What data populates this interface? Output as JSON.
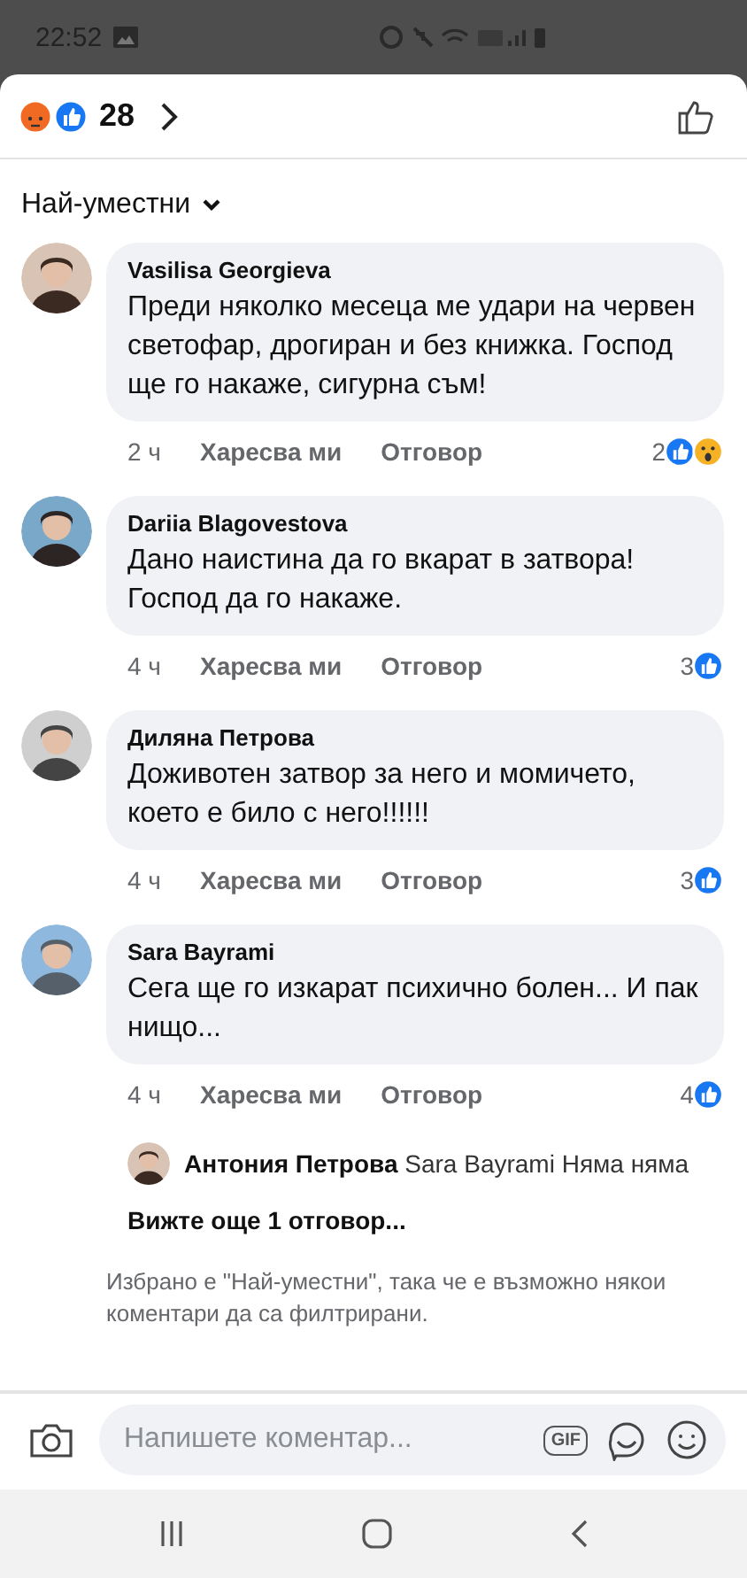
{
  "status_bar": {
    "time": "22:52"
  },
  "header": {
    "reactions": [
      {
        "kind": "angry"
      },
      {
        "kind": "like"
      }
    ],
    "count": "28"
  },
  "sort": {
    "label": "Най-уместни"
  },
  "comments": [
    {
      "author": "Vasilisa Georgieva",
      "text": "Преди няколко месеца ме удари на червен светофар, дрогиран и без книжка. Господ ще го накаже, сигурна съм!",
      "time": "2 ч",
      "like": "Харесва ми",
      "reply": "Отговор",
      "reaction_count": "2",
      "reactions": [
        {
          "kind": "like"
        },
        {
          "kind": "wow"
        }
      ]
    },
    {
      "author": "Dariia Blagovestova",
      "text": "Дано наистина да го вкарат в затвора! Господ да го накаже.",
      "time": "4 ч",
      "like": "Харесва ми",
      "reply": "Отговор",
      "reaction_count": "3",
      "reactions": [
        {
          "kind": "like"
        }
      ]
    },
    {
      "author": "Диляна Петрова",
      "text": "Доживотен затвор за  него и момичето, което е било с него!!!!!!",
      "time": "4 ч",
      "like": "Харесва ми",
      "reply": "Отговор",
      "reaction_count": "3",
      "reactions": [
        {
          "kind": "like"
        }
      ]
    },
    {
      "author": "Sara Bayrami",
      "text": "Сега ще го изкарат психично болен... И пак нищо...",
      "time": "4 ч",
      "like": "Харесва ми",
      "reply": "Отговор",
      "reaction_count": "4",
      "reactions": [
        {
          "kind": "like"
        }
      ],
      "replies": [
        {
          "author": "Антония Петрова",
          "text": "Sara Bayrami Няма няма"
        }
      ],
      "more_replies": "Вижте още 1 отговор..."
    }
  ],
  "filter_note": "Избрано е \"Най-уместни\", така че е възможно някои коментари да са филтрирани.",
  "composer": {
    "placeholder": "Напишете коментар...",
    "gif": "GIF"
  }
}
